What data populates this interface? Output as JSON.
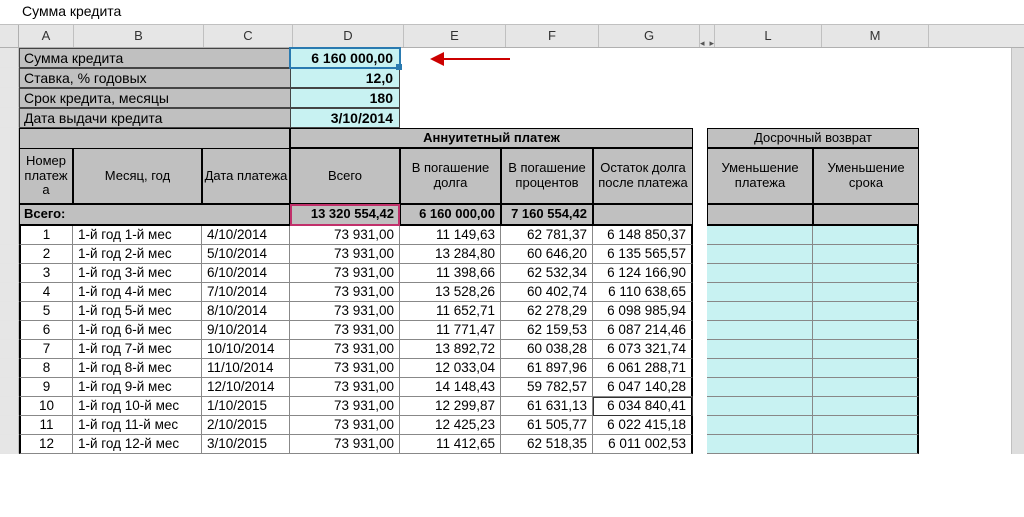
{
  "formula_bar": "Сумма кредита",
  "columns": [
    "A",
    "B",
    "C",
    "D",
    "E",
    "F",
    "G",
    "L",
    "M"
  ],
  "gap_left": "◂",
  "gap_right": "▸",
  "params": [
    {
      "label": "Сумма кредита",
      "value": "6 160 000,00",
      "sel": true
    },
    {
      "label": "Ставка, % годовых",
      "value": "12,0"
    },
    {
      "label": "Срок кредита, месяцы",
      "value": "180"
    },
    {
      "label": "Дата выдачи кредита",
      "value": "3/10/2014"
    }
  ],
  "hdr": {
    "num": "Номер платеж а",
    "month": "Месяц, год",
    "date": "Дата платежа",
    "annuity_group": "Аннуитетный платеж",
    "early_group": "Досрочный возврат",
    "total": "Всего",
    "principal": "В погашение долга",
    "interest": "В погашение процентов",
    "balance": "Остаток долга после платежа",
    "reduce_pay": "Уменьшение платежа",
    "reduce_term": "Уменьшение срока",
    "totals_label": "Всего:"
  },
  "totals": {
    "d": "13 320 554,42",
    "e": "6 160 000,00",
    "f": "7 160 554,42"
  },
  "rows": [
    {
      "n": "1",
      "m": "1-й год 1-й мес",
      "d": "4/10/2014",
      "t": "73 931,00",
      "p": "11 149,63",
      "i": "62 781,37",
      "b": "6 148 850,37"
    },
    {
      "n": "2",
      "m": "1-й год 2-й мес",
      "d": "5/10/2014",
      "t": "73 931,00",
      "p": "13 284,80",
      "i": "60 646,20",
      "b": "6 135 565,57"
    },
    {
      "n": "3",
      "m": "1-й год 3-й мес",
      "d": "6/10/2014",
      "t": "73 931,00",
      "p": "11 398,66",
      "i": "62 532,34",
      "b": "6 124 166,90"
    },
    {
      "n": "4",
      "m": "1-й год 4-й мес",
      "d": "7/10/2014",
      "t": "73 931,00",
      "p": "13 528,26",
      "i": "60 402,74",
      "b": "6 110 638,65"
    },
    {
      "n": "5",
      "m": "1-й год 5-й мес",
      "d": "8/10/2014",
      "t": "73 931,00",
      "p": "11 652,71",
      "i": "62 278,29",
      "b": "6 098 985,94"
    },
    {
      "n": "6",
      "m": "1-й год 6-й мес",
      "d": "9/10/2014",
      "t": "73 931,00",
      "p": "11 771,47",
      "i": "62 159,53",
      "b": "6 087 214,46"
    },
    {
      "n": "7",
      "m": "1-й год 7-й мес",
      "d": "10/10/2014",
      "t": "73 931,00",
      "p": "13 892,72",
      "i": "60 038,28",
      "b": "6 073 321,74"
    },
    {
      "n": "8",
      "m": "1-й год 8-й мес",
      "d": "11/10/2014",
      "t": "73 931,00",
      "p": "12 033,04",
      "i": "61 897,96",
      "b": "6 061 288,71"
    },
    {
      "n": "9",
      "m": "1-й год 9-й мес",
      "d": "12/10/2014",
      "t": "73 931,00",
      "p": "14 148,43",
      "i": "59 782,57",
      "b": "6 047 140,28"
    },
    {
      "n": "10",
      "m": "1-й год 10-й мес",
      "d": "1/10/2015",
      "t": "73 931,00",
      "p": "12 299,87",
      "i": "61 631,13",
      "b": "6 034 840,41",
      "sel": true
    },
    {
      "n": "11",
      "m": "1-й год 11-й мес",
      "d": "2/10/2015",
      "t": "73 931,00",
      "p": "12 425,23",
      "i": "61 505,77",
      "b": "6 022 415,18"
    },
    {
      "n": "12",
      "m": "1-й год 12-й мес",
      "d": "3/10/2015",
      "t": "73 931,00",
      "p": "11 412,65",
      "i": "62 518,35",
      "b": "6 011 002,53"
    }
  ]
}
